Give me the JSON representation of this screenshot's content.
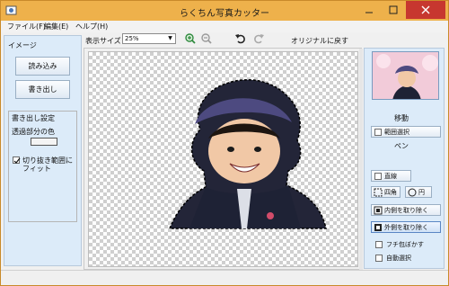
{
  "window": {
    "title": "らくちん写真カッター"
  },
  "menu": {
    "file": "ファイル(F)",
    "edit": "編集(E)",
    "help": "ヘルプ(H)"
  },
  "left_panel": {
    "section": "イメージ",
    "load": "読み込み",
    "export": "書き出し",
    "export_settings": "書き出し設定",
    "transparent_color": "透過部分の色",
    "fit_line1": "切り抜き範囲に",
    "fit_line2": "フィット"
  },
  "toolbar": {
    "zoom_label": "表示サイズ",
    "zoom_value": "25%",
    "reset": "オリジナルに戻す"
  },
  "right_panel": {
    "move": "移動",
    "range_select": "範囲選択",
    "pen": "ペン",
    "straight": "直線",
    "square": "四角",
    "circle": "円",
    "cut_inside": "内側を取り除く",
    "cut_outside": "外側を取り除く",
    "blur_edge": "フチ包ぼかす",
    "auto_select": "自動選択"
  },
  "colors": {
    "titlebar": "#eeb14b",
    "close": "#c7372f",
    "panel": "#dcebf9"
  },
  "icons": [
    "app-icon",
    "minimize-icon",
    "maximize-icon",
    "close-icon",
    "zoom-in-icon",
    "zoom-out-icon",
    "undo-icon",
    "redo-icon"
  ]
}
